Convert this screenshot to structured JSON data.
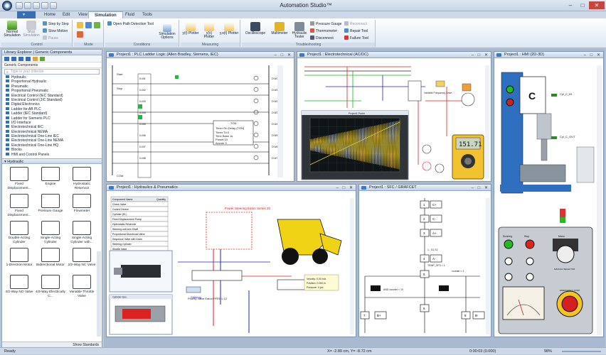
{
  "app": {
    "title": "Automation Studio™",
    "status": "Ready"
  },
  "window_controls": {
    "minimize": "–",
    "maximize": "□",
    "close": "✕"
  },
  "menu": {
    "tabs": [
      "Home",
      "Edit",
      "View",
      "Simulation",
      "Fluid",
      "Tools"
    ],
    "active": "Simulation"
  },
  "ribbon": {
    "control": {
      "label": "Control",
      "normal": "Normal Simulation",
      "stop": "Stop Simulation",
      "step": "Step by Step",
      "slow": "Slow Motion",
      "pause": "Pause"
    },
    "mode": {
      "label": "Mode"
    },
    "conditions": {
      "label": "Conditions",
      "open_path": "Open Path Detection Tool",
      "sim_options": "Simulation Options"
    },
    "measuring": {
      "label": "Measuring",
      "yt": "y(t) Plotter",
      "yx": "y(x) Plotter",
      "yxy": "y,x(t) Plotter"
    },
    "troubleshooting": {
      "label": "Troubleshooting",
      "oscilloscope": "Oscilloscope",
      "multimeter": "Multimeter",
      "hydraulic_tester": "Hydraulic Tester",
      "pressure_gauge": "Pressure Gauge",
      "thermometer": "Thermometer",
      "disconnect": "Disconnect",
      "reconnect": "Reconnect",
      "repair": "Repair Tool",
      "failure": "Failure Tool"
    }
  },
  "library": {
    "title": "Library Explorer | Generic Components",
    "subheader": "Generic Components",
    "search_placeholder": "Type in your criterion",
    "tree": [
      "Hydraulic",
      "Proportional Hydraulic",
      "Pneumatic",
      "Proportional Pneumatic",
      "Electrical Control (IEC Standard)",
      "Electrical Control (JIC Standard)",
      "Digital Electronics",
      "Ladder for AB PLC",
      "Ladder (IEC Standard)",
      "Ladder for Siemens PLC",
      "I/O Interface",
      "Electrotechnical IEC",
      "Electrotechnical NEMA",
      "Electrotechnical One-Line IEC",
      "Electrotechnical One-Line NEMA",
      "Electrotechnical One-Line HQ",
      "Blocks",
      "HMI and Control Panels"
    ],
    "section": "Hydraulic",
    "components": [
      "Fixed Displacement...",
      "Engine",
      "Hydrostatic Reservoir",
      "Fixed Displacement...",
      "Pressure Gauge",
      "Flowmeter",
      "Double-Acting Cylinder",
      "Single-Acting Cylinder",
      "Single-Acting Cylinder with...",
      "1-Direction Motor",
      "Bidirectional Motor",
      "2/2-Way NC Valve",
      "4/2-Way NO Valve",
      "4/3-Way Electrically C...",
      "Variable Throttle Valve"
    ],
    "show_standards": "Show Standards"
  },
  "docs": {
    "plc": {
      "title": "Project1 : PLC Ladder Logic (Allen Bradley, Siemens, IEC)",
      "start": "Start",
      "stop": "Stop",
      "inputs": [
        "I1:0/1",
        "I1:0/2",
        "I1:0/3",
        "I1:0/4",
        "I1:0/5",
        "I1:0/6",
        "I1:0/7",
        "I1:0/8"
      ],
      "outputs": [
        "O:0/0",
        "O:0/1",
        "O:0/2",
        "O:0/3",
        "O:0/4",
        "O:0/5",
        "O:0/6",
        "O:0/7"
      ],
      "timer_title": "TON",
      "timer_rows": [
        "Timer On-Delay (TON)",
        "Timer  T4:0",
        "Time Base  1s",
        "Preset  10",
        "Accum  3"
      ],
      "com": "COM"
    },
    "elec": {
      "title": "Project1 : Electrotechnical (AC/DC)",
      "scope_title": "Project1 Probe",
      "multimeter_value": "151.71",
      "vfd_label": "Variable Frequency Drive"
    },
    "hmi": {
      "title": "Project1 : HMI (2D-3D)",
      "cyl_in": "Cyl_C_IN",
      "cyl_out": "Cyl_C_OUT",
      "label_c": "C",
      "panel_buttons": [
        "Running",
        "Stop",
        "Manu"
      ],
      "selector": "MANUAL SELECTOR",
      "estop": "EMERGENCY STOP"
    },
    "hyd": {
      "title": "Project1 : Hydraulics & Pneumatics",
      "table_header": [
        "Component Name",
        "Quantity"
      ],
      "table_rows": [
        "Check Valve",
        "Control Device",
        "Cylinder (EL)",
        "Fixed Displacement Pump",
        "Hydrostatic Reservoir",
        "Steering unit arm Shaft",
        "Proportional Directional Valve",
        "Sequence Valve with Drain",
        "Steering Cylinder",
        "Shuttle Valve"
      ],
      "power_steering": "Power Steering Eaton Series 20",
      "priority_valve": "Priority Valve Eaton PFRD1-12",
      "cylinder_tab": "Cylinder Sec.",
      "steering_text": "Steering",
      "tooltip": [
        "Velocity: 0.00 in/s",
        "Position: 0.000 in",
        "Pressure: 0 psi"
      ]
    },
    "sfc": {
      "title": "Project1 : SFC / GRAFCET",
      "steps": [
        "1",
        "2",
        "3",
        "4",
        "5",
        "6",
        "7",
        "8"
      ],
      "actions": [
        "C+",
        "C-",
        "A+",
        "A-",
        "B+",
        "B-"
      ],
      "labels": [
        "1 - S1.S2",
        "TEMP_OP3 = 1",
        "counter:= 1",
        "AND counter < 10"
      ]
    }
  },
  "status": {
    "coords": "X= -2.89 cm, Y= -8.72 cm",
    "time": "0:00:03 (0.000)",
    "zoom": "98%"
  }
}
